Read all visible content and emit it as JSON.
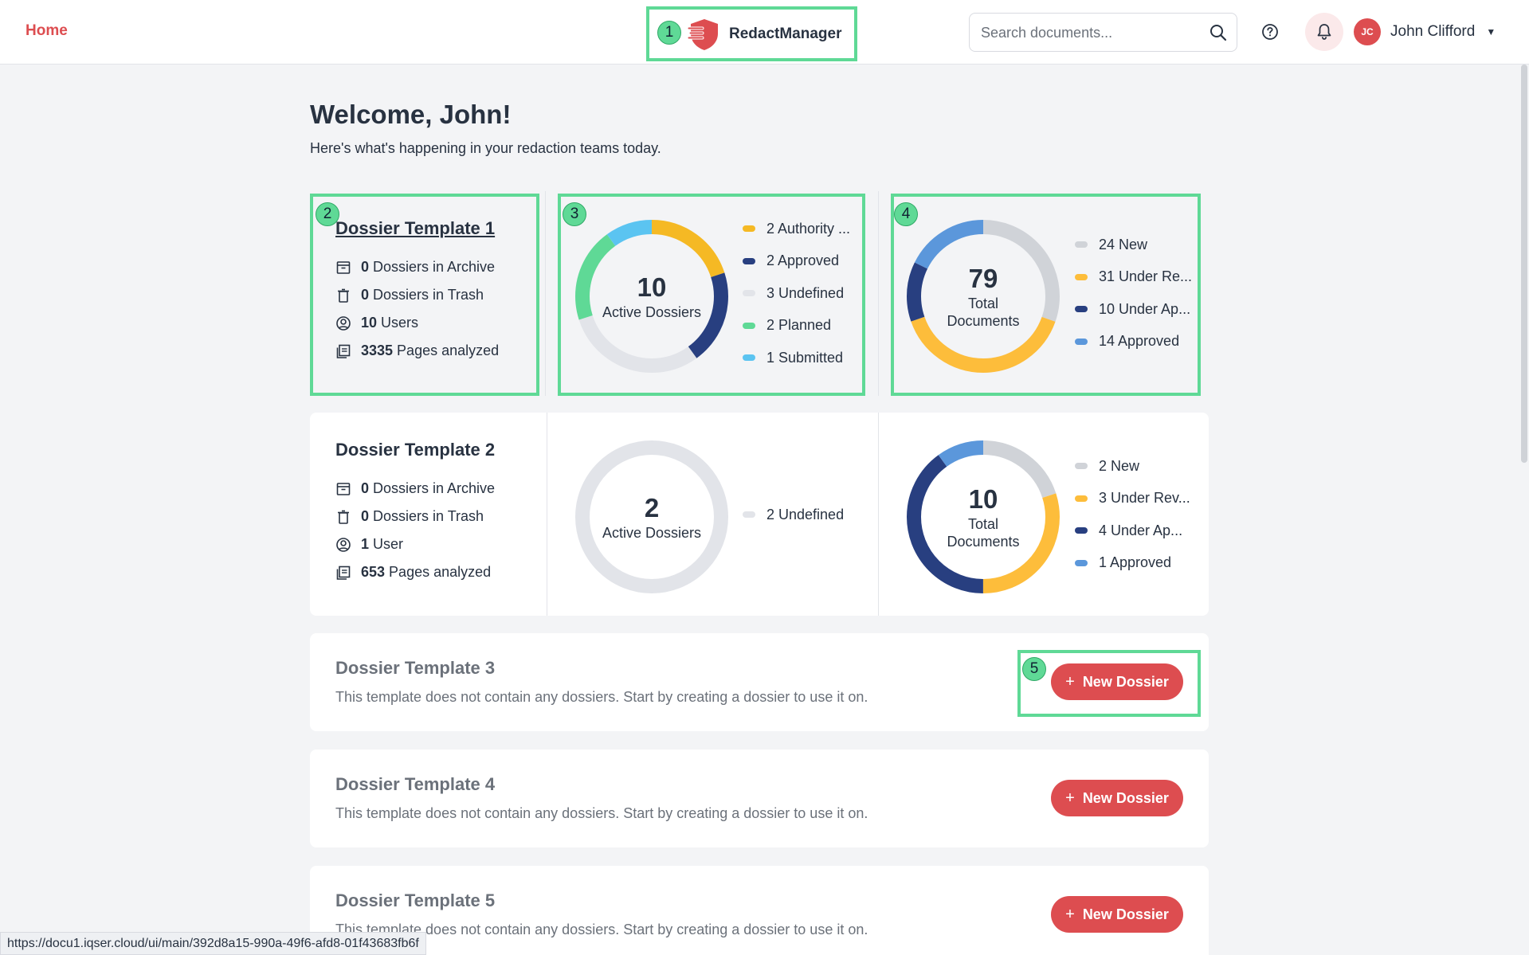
{
  "nav": {
    "home_label": "Home",
    "brand_name": "RedactManager",
    "search_placeholder": "Search documents...",
    "user_initials": "JC",
    "user_name": "John Clifford"
  },
  "main": {
    "welcome": "Welcome, John!",
    "subtitle": "Here's what's happening in your redaction teams today."
  },
  "templates": [
    {
      "name": "Dossier Template 1",
      "stats": [
        {
          "value": "0",
          "label": "Dossiers in Archive",
          "icon": "archive-icon"
        },
        {
          "value": "0",
          "label": "Dossiers in Trash",
          "icon": "trash-icon"
        },
        {
          "value": "10",
          "label": "Users",
          "icon": "user-icon"
        },
        {
          "value": "3335",
          "label": "Pages analyzed",
          "icon": "pages-icon"
        }
      ],
      "dossiers": {
        "total": "10",
        "label": "Active Dossiers",
        "legend": [
          {
            "text": "2 Authority ...",
            "value": 2,
            "color": "#f5b924"
          },
          {
            "text": "2 Approved",
            "value": 2,
            "color": "#283f80"
          },
          {
            "text": "3 Undefined",
            "value": 3,
            "color": "#e2e4e9"
          },
          {
            "text": "2 Planned",
            "value": 2,
            "color": "#5fd996"
          },
          {
            "text": "1 Submitted",
            "value": 1,
            "color": "#5bc4f1"
          }
        ]
      },
      "documents": {
        "total": "79",
        "label": "Total Documents",
        "legend": [
          {
            "text": "24 New",
            "value": 24,
            "color": "#d0d3d8"
          },
          {
            "text": "31 Under Re...",
            "value": 31,
            "color": "#fdbd3b"
          },
          {
            "text": "10 Under Ap...",
            "value": 10,
            "color": "#283f80"
          },
          {
            "text": "14 Approved",
            "value": 14,
            "color": "#5b97db"
          }
        ]
      }
    },
    {
      "name": "Dossier Template 2",
      "stats": [
        {
          "value": "0",
          "label": "Dossiers in Archive",
          "icon": "archive-icon"
        },
        {
          "value": "0",
          "label": "Dossiers in Trash",
          "icon": "trash-icon"
        },
        {
          "value": "1",
          "label": "User",
          "icon": "user-icon"
        },
        {
          "value": "653",
          "label": "Pages analyzed",
          "icon": "pages-icon"
        }
      ],
      "dossiers": {
        "total": "2",
        "label": "Active Dossiers",
        "legend": [
          {
            "text": "2 Undefined",
            "value": 2,
            "color": "#e2e4e9"
          }
        ]
      },
      "documents": {
        "total": "10",
        "label": "Total Documents",
        "legend": [
          {
            "text": "2 New",
            "value": 2,
            "color": "#d0d3d8"
          },
          {
            "text": "3 Under Rev...",
            "value": 3,
            "color": "#fdbd3b"
          },
          {
            "text": "4 Under Ap...",
            "value": 4,
            "color": "#283f80"
          },
          {
            "text": "1 Approved",
            "value": 1,
            "color": "#5b97db"
          }
        ]
      }
    }
  ],
  "empty_templates": [
    {
      "name": "Dossier Template 3",
      "text": "This template does not contain any dossiers. Start by creating a dossier to use it on.",
      "button": "New Dossier"
    },
    {
      "name": "Dossier Template 4",
      "text": "This template does not contain any dossiers. Start by creating a dossier to use it on.",
      "button": "New Dossier"
    },
    {
      "name": "Dossier Template 5",
      "text": "This template does not contain any dossiers. Start by creating a dossier to use it on.",
      "button": "New Dossier"
    }
  ],
  "annotations": [
    "1",
    "2",
    "3",
    "4",
    "5"
  ],
  "status_url": "https://docu1.iqser.cloud/ui/main/392d8a15-990a-49f6-afd8-01f43683fb6f",
  "colors": {
    "accent": "#dd4d50",
    "highlight": "#5fd996"
  }
}
